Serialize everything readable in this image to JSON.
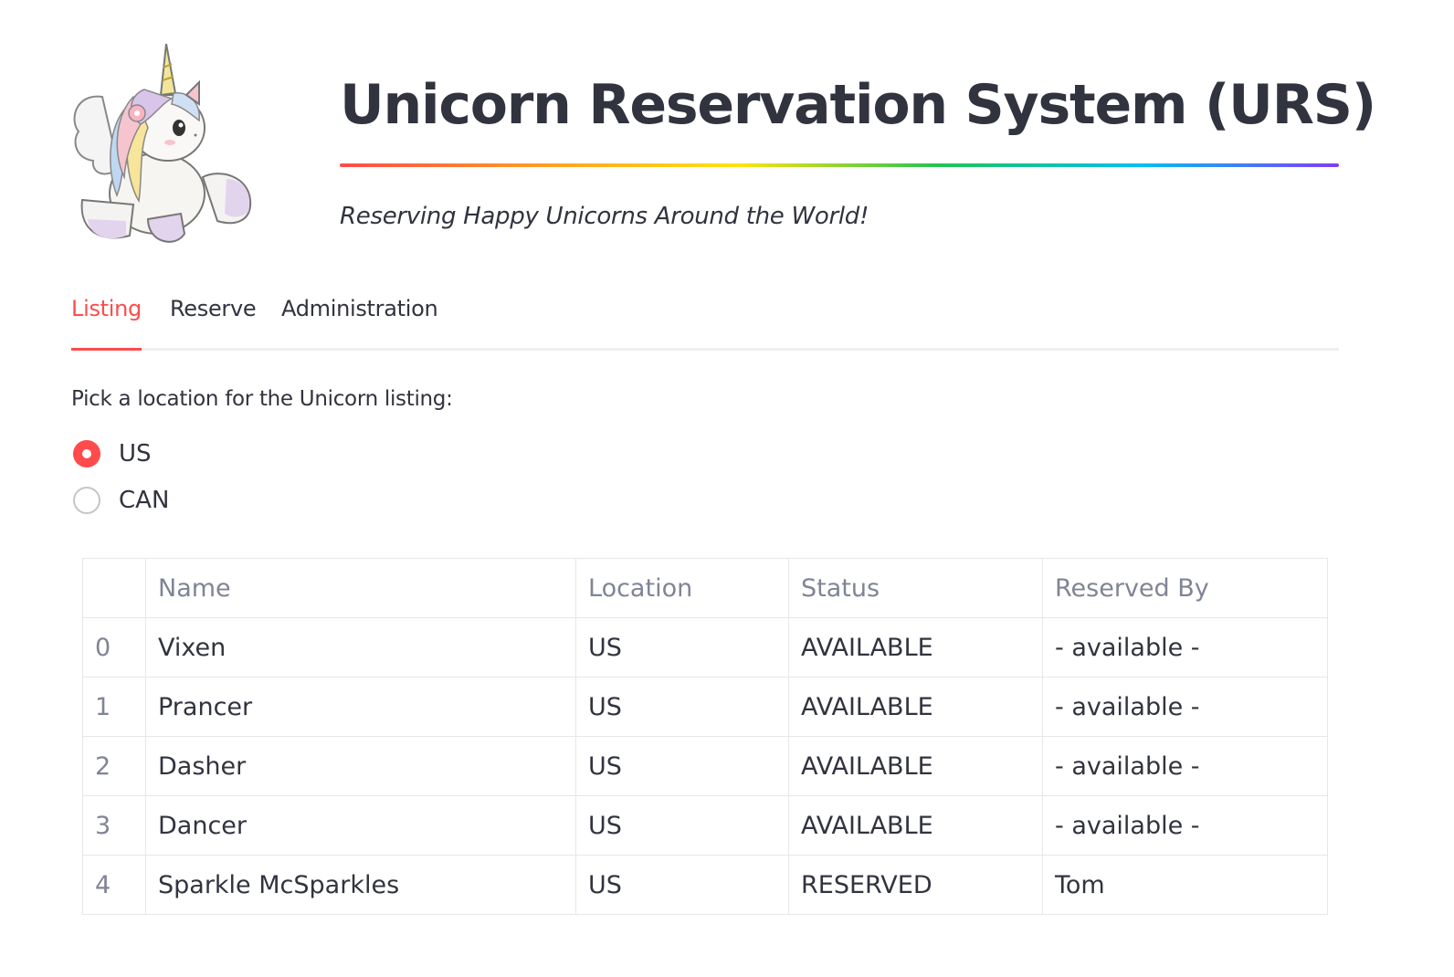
{
  "header": {
    "title": "Unicorn Reservation System (URS)",
    "subtitle": "Reserving Happy Unicorns Around the World!",
    "logo": "unicorn-mascot-logo"
  },
  "tabs": [
    {
      "label": "Listing",
      "active": true
    },
    {
      "label": "Reserve",
      "active": false
    },
    {
      "label": "Administration",
      "active": false
    }
  ],
  "location_picker": {
    "label": "Pick a location for the Unicorn listing:",
    "options": [
      {
        "label": "US",
        "selected": true
      },
      {
        "label": "CAN",
        "selected": false
      }
    ]
  },
  "table": {
    "columns": [
      "",
      "Name",
      "Location",
      "Status",
      "Reserved By"
    ],
    "rows": [
      [
        "0",
        "Vixen",
        "US",
        "AVAILABLE",
        "- available -"
      ],
      [
        "1",
        "Prancer",
        "US",
        "AVAILABLE",
        "- available -"
      ],
      [
        "2",
        "Dasher",
        "US",
        "AVAILABLE",
        "- available -"
      ],
      [
        "3",
        "Dancer",
        "US",
        "AVAILABLE",
        "- available -"
      ],
      [
        "4",
        "Sparkle McSparkles",
        "US",
        "RESERVED",
        "Tom"
      ]
    ]
  },
  "colors": {
    "accent": "#ff4b4b",
    "text": "#31333f",
    "muted": "#808495",
    "border": "#e6e7ea"
  }
}
